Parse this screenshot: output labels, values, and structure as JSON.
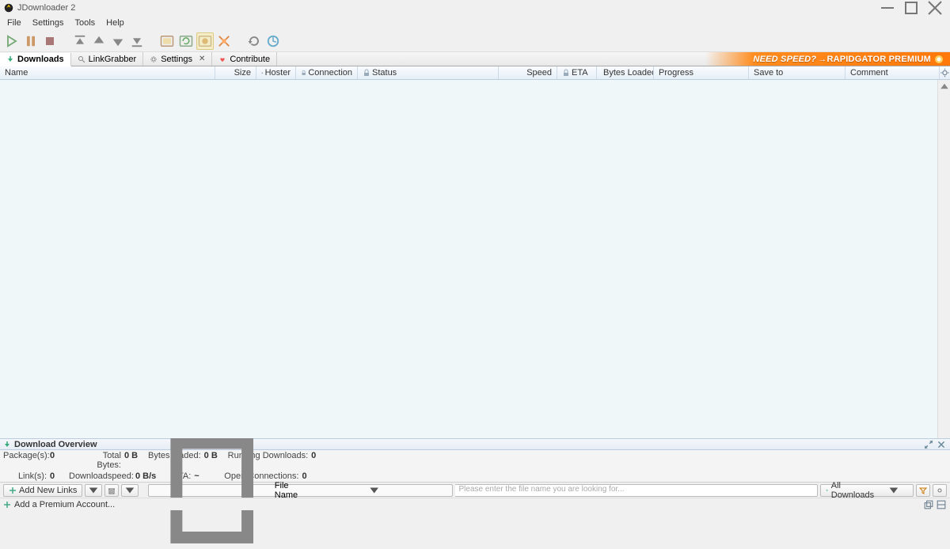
{
  "window": {
    "title": "JDownloader 2"
  },
  "menu": {
    "file": "File",
    "settings": "Settings",
    "tools": "Tools",
    "help": "Help"
  },
  "tabs": {
    "downloads": "Downloads",
    "linkgrabber": "LinkGrabber",
    "settings": "Settings",
    "contribute": "Contribute"
  },
  "banner": {
    "text1": "NEED SPEED?",
    "text2": "→RAPIDGATOR PREMIUM"
  },
  "columns": {
    "name": "Name",
    "size": "Size",
    "hoster": "Hoster",
    "connection": "Connection",
    "status": "Status",
    "speed": "Speed",
    "eta": "ETA",
    "bytes_loaded": "Bytes Loaded",
    "progress": "Progress",
    "save_to": "Save to",
    "comment": "Comment"
  },
  "overview": {
    "title": "Download Overview",
    "row1": {
      "packages_label": "Package(s):",
      "packages_val": "0",
      "total_bytes_label": "Total Bytes:",
      "total_bytes_val": "0 B",
      "bytes_loaded_label": "Bytes loaded:",
      "bytes_loaded_val": "0 B",
      "running_label": "Running Downloads:",
      "running_val": "0"
    },
    "row2": {
      "links_label": "Link(s):",
      "links_val": "0",
      "dlspeed_label": "Downloadspeed:",
      "dlspeed_val": "0 B/s",
      "eta_label": "ETA:",
      "eta_val": "~",
      "openconn_label": "Open Connections:",
      "openconn_val": "0"
    }
  },
  "bottom": {
    "add_new_links": "Add New Links",
    "filename_label": "File Name",
    "search_placeholder": "Please enter the file name you are looking for...",
    "all_downloads": "All Downloads"
  },
  "status": {
    "add_premium": "Add a Premium Account..."
  }
}
